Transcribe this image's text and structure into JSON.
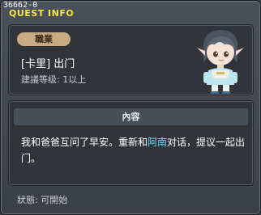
{
  "window": {
    "id": "36662-0",
    "title": "QUEST INFO"
  },
  "quest": {
    "job_badge": "職業",
    "name": "[卡里] 出门",
    "level_requirement": "建議等级: 1以上"
  },
  "content": {
    "header": "內容",
    "text_before": "我和爸爸互问了早安。重新和",
    "npc_name": "阿南",
    "text_after": "对话，提议一起出门。"
  },
  "status": {
    "text": "狀態: 可開始"
  },
  "colors": {
    "title": "#f3e640",
    "npc_highlight": "#5fe0ff",
    "job_badge_bg": "#c6ab84"
  },
  "icons": {
    "portrait": "npc-portrait-icon"
  }
}
